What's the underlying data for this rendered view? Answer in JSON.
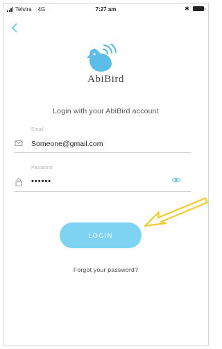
{
  "status_bar": {
    "carrier": "Telstra",
    "network": "4G",
    "time": "7:27 am"
  },
  "brand": {
    "name": "AbiBird",
    "color": "#5bbde8"
  },
  "login": {
    "subtitle": "Login with your AbiBird account",
    "email_label": "Email",
    "email_value": "Someone@gmail.com",
    "password_label": "Password",
    "password_value": "••••••",
    "button_label": "LOGIN",
    "forgot_link": "Forgot your password?"
  },
  "colors": {
    "button": "#7fd3f2",
    "annotation_arrow": "#f2cc2e"
  },
  "icons": {
    "back": "chevron-left-icon",
    "email": "envelope-icon",
    "password": "lock-icon",
    "show_password": "eye-icon",
    "bluetooth": "bluetooth-icon",
    "battery": "battery-icon",
    "signal": "signal-icon"
  }
}
